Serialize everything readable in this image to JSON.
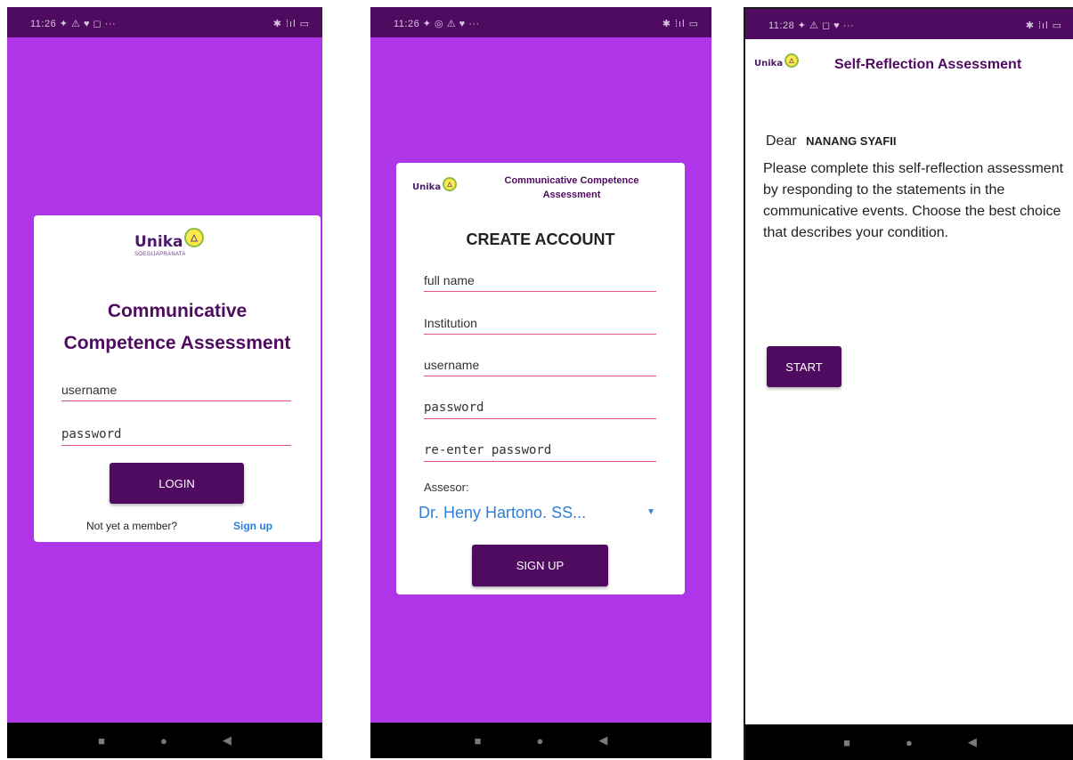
{
  "screens": {
    "login": {
      "status_time": "11:26 ✦ ⚠ ♥ ◻ ···",
      "status_right": "✱ ⁞ıl ▭",
      "logo_text": "Unika",
      "logo_sub": "SOEGIJAPRANATA",
      "title_line1": "Communicative",
      "title_line2": "Competence Assessment",
      "username_placeholder": "username",
      "password_placeholder": "password",
      "login_label": "LOGIN",
      "not_member_text": "Not yet a member?",
      "signup_link": "Sign up"
    },
    "create_account": {
      "status_time": "11:26 ✦ ◎ ⚠ ♥ ···",
      "status_right": "✱ ⁞ıl ▭",
      "logo_text": "Unika",
      "header_title": "Communicative Competence Assessment",
      "heading": "CREATE ACCOUNT",
      "full_name_placeholder": "full name",
      "institution_placeholder": "Institution",
      "username_placeholder": "username",
      "password_placeholder": "password",
      "reenter_placeholder": "re-enter password",
      "assessor_label": "Assesor:",
      "assessor_selected": "Dr. Heny Hartono. SS...",
      "signup_label": "SIGN UP"
    },
    "self_reflection": {
      "status_time": "11:28 ✦ ⚠ ◻ ♥ ···",
      "status_right": "✱ ⁞ıl ▭",
      "logo_text": "Unika",
      "header_title": "Self-Reflection Assessment",
      "dear_label": "Dear",
      "user_name": "NANANG SYAFII",
      "instructions": "Please complete this self-reflection assessment by responding to the statements in the communicative events. Choose the best choice that describes your condition.",
      "start_label": "START"
    }
  },
  "nav": {
    "recents": "■",
    "home": "●",
    "back": "◀"
  },
  "colors": {
    "primary_dark": "#4f0b60",
    "background_purple": "#ae35e8",
    "field_underline": "#e2547e",
    "link_blue": "#2e7fd6"
  },
  "icons": {
    "dropdown": "caret-down-icon",
    "logo_badge": "unika-logo-icon"
  }
}
